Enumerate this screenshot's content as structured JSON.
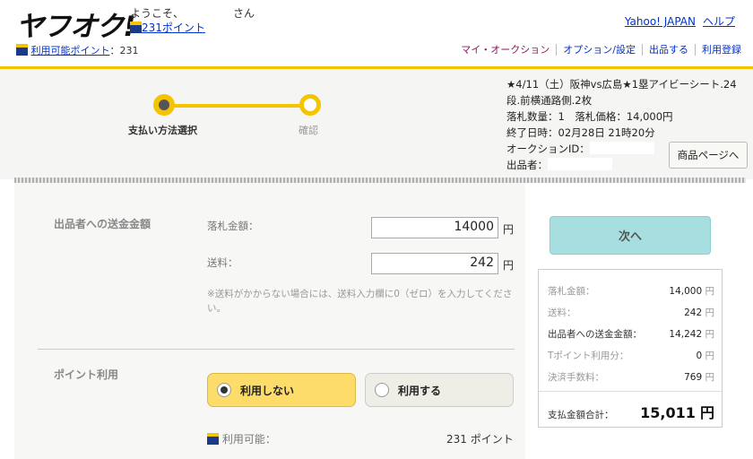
{
  "header": {
    "logo": "ヤフオク!",
    "welcome": "ようこそ、",
    "welcome_suffix": "さん",
    "points_link": "231ポイント",
    "top_links": [
      "Yahoo! JAPAN",
      "ヘルプ"
    ],
    "available_points_label": "利用可能ポイント",
    "available_points_value": "：231",
    "nav_links": [
      "マイ・オークション",
      "オプション/設定",
      "出品する",
      "利用登録"
    ]
  },
  "steps": {
    "step1": "支払い方法選択",
    "step2": "確認"
  },
  "item": {
    "title_line1": "★4/11（土）阪神vs広島★1塁アイビーシート.24",
    "title_line2": "段.前横通路側.2枚",
    "bid_info": "落札数量：1　落札価格：14,000円",
    "end_time": "終了日時：02月28日 21時20分",
    "auction_id_label": "オークションID：",
    "seller_label": "出品者：",
    "product_page_button": "商品ページへ"
  },
  "form": {
    "section1_title": "出品者への送金金額",
    "price_label": "落札金額：",
    "price_value": "14000",
    "shipping_label": "送料：",
    "shipping_value": "242",
    "unit": "円",
    "shipping_note": "※送料がかからない場合には、送料入力欄に0（ゼロ）を入力してください。",
    "section2_title": "ポイント利用",
    "radio_no": "利用しない",
    "radio_yes": "利用する",
    "usable_label": "利用可能：",
    "usable_value": "231 ポイント"
  },
  "summary": {
    "next_button": "次へ",
    "rows": [
      {
        "label": "落札金額：",
        "value": "14,000",
        "unit": "円"
      },
      {
        "label": "送料：",
        "value": "242",
        "unit": "円"
      },
      {
        "label": "出品者への送金金額：",
        "value": "14,242",
        "unit": "円"
      },
      {
        "label": "Tポイント利用分：",
        "value": "0",
        "unit": "円"
      },
      {
        "label": "決済手数料：",
        "value": "769",
        "unit": "円"
      }
    ],
    "total_label": "支払金額合計：",
    "total_value": "15,011",
    "total_unit": "円"
  },
  "colors": {
    "accent_yellow": "#f5c400",
    "next_button": "#a7dfe0",
    "selected_radio": "#fddc6a"
  }
}
